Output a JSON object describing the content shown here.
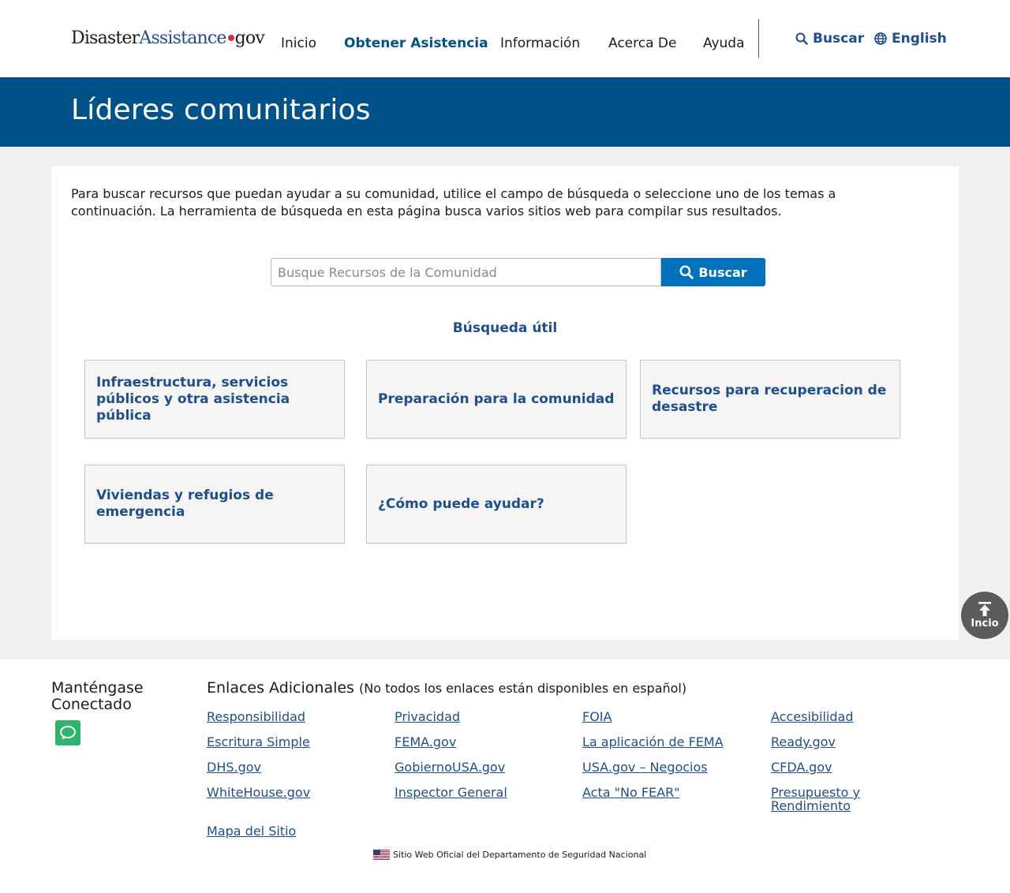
{
  "header": {
    "logo": {
      "part1": "Disaster",
      "part2": "Assistance",
      "part3": "gov"
    },
    "nav": [
      "Inicio",
      "Obtener Asistencia",
      "Información",
      "Acerca De",
      "Ayuda"
    ],
    "search_label": "Buscar",
    "language_label": "English"
  },
  "banner": {
    "title": "Líderes comunitarios"
  },
  "main": {
    "intro": "Para buscar recursos que puedan ayudar a su comunidad, utilice el campo de búsqueda o seleccione uno de los temas a continuación. La herramienta de búsqueda en esta página busca varios sitios web para compilar sus resultados.",
    "search": {
      "placeholder": "Busque Recursos de la Comunidad",
      "value": "",
      "button": "Buscar"
    },
    "helpful_title": "Búsqueda útil",
    "tiles": [
      "Infraestructura, servicios públicos y otra asistencia pública",
      "Preparación para la comunidad",
      "Recursos para recuperacion de desastre",
      "Viviendas y refugios de emergencia",
      "¿Cómo puede ayudar?"
    ],
    "back_to_top": "Incio"
  },
  "footer": {
    "stay_connected": "Manténgase Conectado",
    "links_title": "Enlaces Adicionales",
    "links_note": "(No todos los enlaces están disponibles en español)",
    "links": [
      "Responsibilidad",
      "Privacidad",
      "FOIA",
      "Accesibilidad",
      "Escritura Simple",
      "FEMA.gov",
      "La aplicación de FEMA",
      "Ready.gov",
      "DHS.gov",
      "GobiernoUSA.gov",
      "USA.gov – Negocios",
      "CFDA.gov",
      "WhiteHouse.gov",
      "Inspector General",
      "Acta \"No FEAR\"",
      "Presupuesto y Rendimiento",
      "Mapa del Sitio"
    ],
    "official_site": "Sitio Web Oficial del Departamento de Seguridad Nacional"
  }
}
